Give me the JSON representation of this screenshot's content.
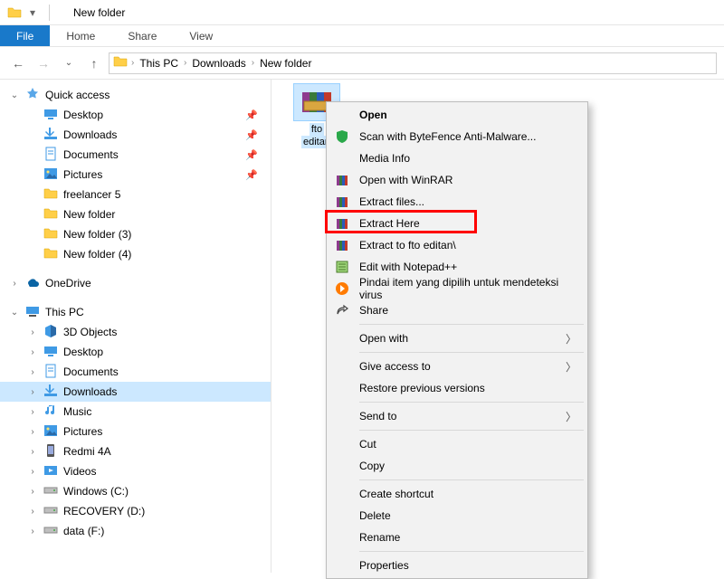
{
  "titlebar": {
    "title": "New folder"
  },
  "ribbon": {
    "file": "File",
    "tabs": [
      "Home",
      "Share",
      "View"
    ]
  },
  "breadcrumb": [
    "This PC",
    "Downloads",
    "New folder"
  ],
  "sidebar": {
    "quick_access": {
      "label": "Quick access"
    },
    "quick_items": [
      {
        "label": "Desktop",
        "icon": "desktop",
        "pinned": true
      },
      {
        "label": "Downloads",
        "icon": "download",
        "pinned": true
      },
      {
        "label": "Documents",
        "icon": "document",
        "pinned": true
      },
      {
        "label": "Pictures",
        "icon": "picture",
        "pinned": true
      },
      {
        "label": "freelancer 5",
        "icon": "folder"
      },
      {
        "label": "New folder",
        "icon": "folder"
      },
      {
        "label": "New folder (3)",
        "icon": "folder"
      },
      {
        "label": "New folder (4)",
        "icon": "folder"
      }
    ],
    "onedrive": {
      "label": "OneDrive"
    },
    "thispc": {
      "label": "This PC"
    },
    "pc_items": [
      {
        "label": "3D Objects",
        "icon": "3d"
      },
      {
        "label": "Desktop",
        "icon": "desktop"
      },
      {
        "label": "Documents",
        "icon": "document"
      },
      {
        "label": "Downloads",
        "icon": "download",
        "selected": true
      },
      {
        "label": "Music",
        "icon": "music"
      },
      {
        "label": "Pictures",
        "icon": "picture"
      },
      {
        "label": "Redmi 4A",
        "icon": "phone"
      },
      {
        "label": "Videos",
        "icon": "video"
      },
      {
        "label": "Windows (C:)",
        "icon": "drive"
      },
      {
        "label": "RECOVERY (D:)",
        "icon": "drive"
      },
      {
        "label": "data (F:)",
        "icon": "drive"
      }
    ]
  },
  "file_item": {
    "line1": "fto",
    "line2": "editan"
  },
  "context_menu": {
    "items": [
      {
        "kind": "item",
        "label": "Open",
        "bold": true
      },
      {
        "kind": "item",
        "label": "Scan with ByteFence Anti-Malware...",
        "icon": "shield-green"
      },
      {
        "kind": "item",
        "label": "Media Info"
      },
      {
        "kind": "item",
        "label": "Open with WinRAR",
        "icon": "books"
      },
      {
        "kind": "item",
        "label": "Extract files...",
        "icon": "books"
      },
      {
        "kind": "item",
        "label": "Extract Here",
        "icon": "books",
        "highlight": true
      },
      {
        "kind": "item",
        "label": "Extract to fto editan\\",
        "icon": "books"
      },
      {
        "kind": "item",
        "label": "Edit with Notepad++",
        "icon": "notepad"
      },
      {
        "kind": "item",
        "label": "Pindai item yang dipilih untuk mendeteksi virus",
        "icon": "avast"
      },
      {
        "kind": "item",
        "label": "Share",
        "icon": "share"
      },
      {
        "kind": "sep"
      },
      {
        "kind": "item",
        "label": "Open with",
        "submenu": true
      },
      {
        "kind": "sep"
      },
      {
        "kind": "item",
        "label": "Give access to",
        "submenu": true
      },
      {
        "kind": "item",
        "label": "Restore previous versions"
      },
      {
        "kind": "sep"
      },
      {
        "kind": "item",
        "label": "Send to",
        "submenu": true
      },
      {
        "kind": "sep"
      },
      {
        "kind": "item",
        "label": "Cut"
      },
      {
        "kind": "item",
        "label": "Copy"
      },
      {
        "kind": "sep"
      },
      {
        "kind": "item",
        "label": "Create shortcut"
      },
      {
        "kind": "item",
        "label": "Delete"
      },
      {
        "kind": "item",
        "label": "Rename"
      },
      {
        "kind": "sep"
      },
      {
        "kind": "item",
        "label": "Properties"
      }
    ]
  }
}
